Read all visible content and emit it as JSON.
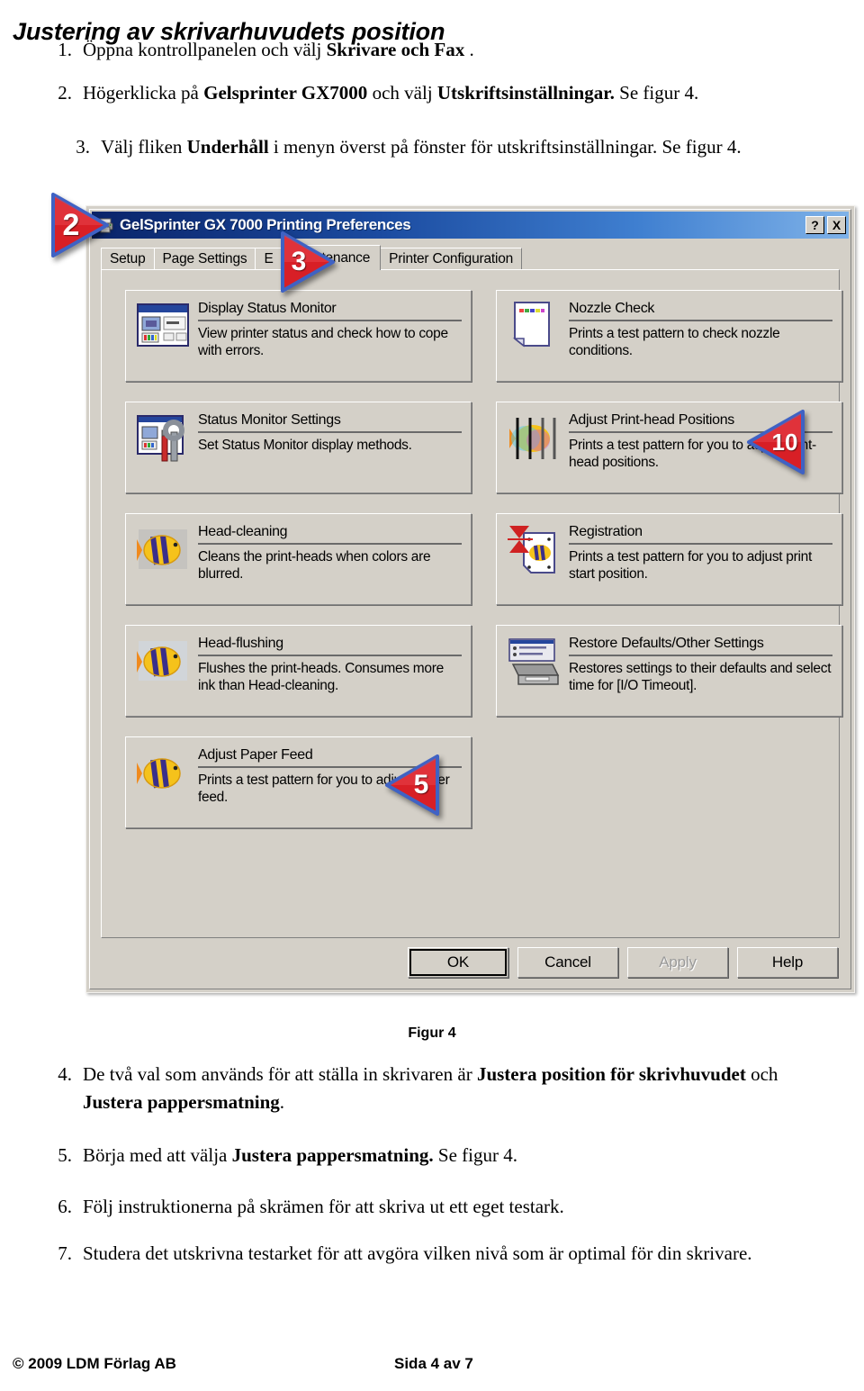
{
  "document": {
    "title": "Justering av skrivarhuvudets position",
    "figure_caption": "Figur 4",
    "steps": [
      {
        "num": "1.",
        "parts": [
          {
            "t": "Öppna kontrollpanelen och välj ",
            "b": false
          },
          {
            "t": "Skrivare och Fax",
            "b": true
          },
          {
            "t": " .",
            "b": false
          }
        ]
      },
      {
        "num": "2.",
        "parts": [
          {
            "t": "Högerklicka på ",
            "b": false
          },
          {
            "t": "Gelsprinter GX7000",
            "b": true
          },
          {
            "t": " och välj ",
            "b": false
          },
          {
            "t": "Utskriftsinställningar.",
            "b": true
          },
          {
            "t": " Se figur 4.",
            "b": false
          }
        ]
      },
      {
        "num": "3.",
        "parts": [
          {
            "t": "Välj fliken ",
            "b": false
          },
          {
            "t": "Underhåll",
            "b": true
          },
          {
            "t": " i menyn överst på fönster för utskriftsinställningar. Se figur 4.",
            "b": false
          }
        ]
      },
      {
        "num": "4.",
        "parts": [
          {
            "t": "De två val som används för att ställa in skrivaren är ",
            "b": false
          },
          {
            "t": "Justera position för skrivhuvudet",
            "b": true
          },
          {
            "t": " och ",
            "b": false
          },
          {
            "t": "Justera pappersmatning",
            "b": true
          },
          {
            "t": ".",
            "b": false
          }
        ]
      },
      {
        "num": "5.",
        "parts": [
          {
            "t": "Börja med att välja ",
            "b": false
          },
          {
            "t": "Justera pappersmatning.",
            "b": true
          },
          {
            "t": " Se figur 4.",
            "b": false
          }
        ]
      },
      {
        "num": "6.",
        "parts": [
          {
            "t": "Följ instruktionerna på skrämen för att skriva ut ett eget testark.",
            "b": false
          }
        ]
      },
      {
        "num": "7.",
        "parts": [
          {
            "t": "Studera det utskrivna testarket för att avgöra vilken nivå som är optimal för din skrivare.",
            "b": false
          }
        ]
      }
    ],
    "footer": {
      "copyright": "© 2009 LDM Förlag AB",
      "page": "Sida 4 av 7"
    }
  },
  "dialog": {
    "title": "GelSprinter GX 7000 Printing Preferences",
    "title_icon": "printer-icon",
    "help_button": "?",
    "close_button": "X",
    "tabs": [
      {
        "label": "Setup",
        "selected": false
      },
      {
        "label": "Page Settings",
        "selected": false
      },
      {
        "label": "E",
        "selected": false
      },
      {
        "label": "Maintenance",
        "selected": true
      },
      {
        "label": "Printer Configuration",
        "selected": false
      }
    ],
    "maintenance_items_left": [
      {
        "title": "Display Status Monitor",
        "desc": "View printer status and check how to cope with errors.",
        "icon": "status-monitor-window-icon"
      },
      {
        "title": "Status Monitor Settings",
        "desc": "Set Status Monitor display methods.",
        "icon": "status-monitor-settings-icon"
      },
      {
        "title": "Head-cleaning",
        "desc": "Cleans the print-heads when colors are blurred.",
        "icon": "head-cleaning-fish-icon"
      },
      {
        "title": "Head-flushing",
        "desc": "Flushes the print-heads. Consumes more ink than Head-cleaning.",
        "icon": "head-flushing-fish-icon"
      },
      {
        "title": "Adjust Paper Feed",
        "desc": "Prints a test pattern for you to adjust paper feed.",
        "icon": "paper-feed-fish-icon"
      }
    ],
    "maintenance_items_right": [
      {
        "title": "Nozzle Check",
        "desc": "Prints a test pattern to check nozzle conditions.",
        "icon": "nozzle-check-page-icon"
      },
      {
        "title": "Adjust Print-head Positions",
        "desc": "Prints a test pattern for you to adjust print-head positions.",
        "icon": "print-head-positions-icon"
      },
      {
        "title": "Registration",
        "desc": "Prints a test pattern for you to adjust print start position.",
        "icon": "registration-icon"
      },
      {
        "title": "Restore Defaults/Other Settings",
        "desc": "Restores settings to their defaults and select time for [I/O Timeout].",
        "icon": "restore-defaults-printer-icon"
      }
    ],
    "buttons": [
      {
        "label": "OK",
        "state": "default"
      },
      {
        "label": "Cancel",
        "state": "normal"
      },
      {
        "label": "Apply",
        "state": "disabled"
      },
      {
        "label": "Help",
        "state": "normal"
      }
    ]
  },
  "callouts": [
    {
      "number": "2",
      "direction": "right"
    },
    {
      "number": "3",
      "direction": "right"
    },
    {
      "number": "10",
      "direction": "left"
    },
    {
      "number": "5",
      "direction": "left"
    }
  ],
  "colors": {
    "callout_red": "#d81f26",
    "callout_blue": "#3f62c4",
    "titlebar_blue": "#0a246a",
    "dialog_face": "#d4d0c8"
  }
}
